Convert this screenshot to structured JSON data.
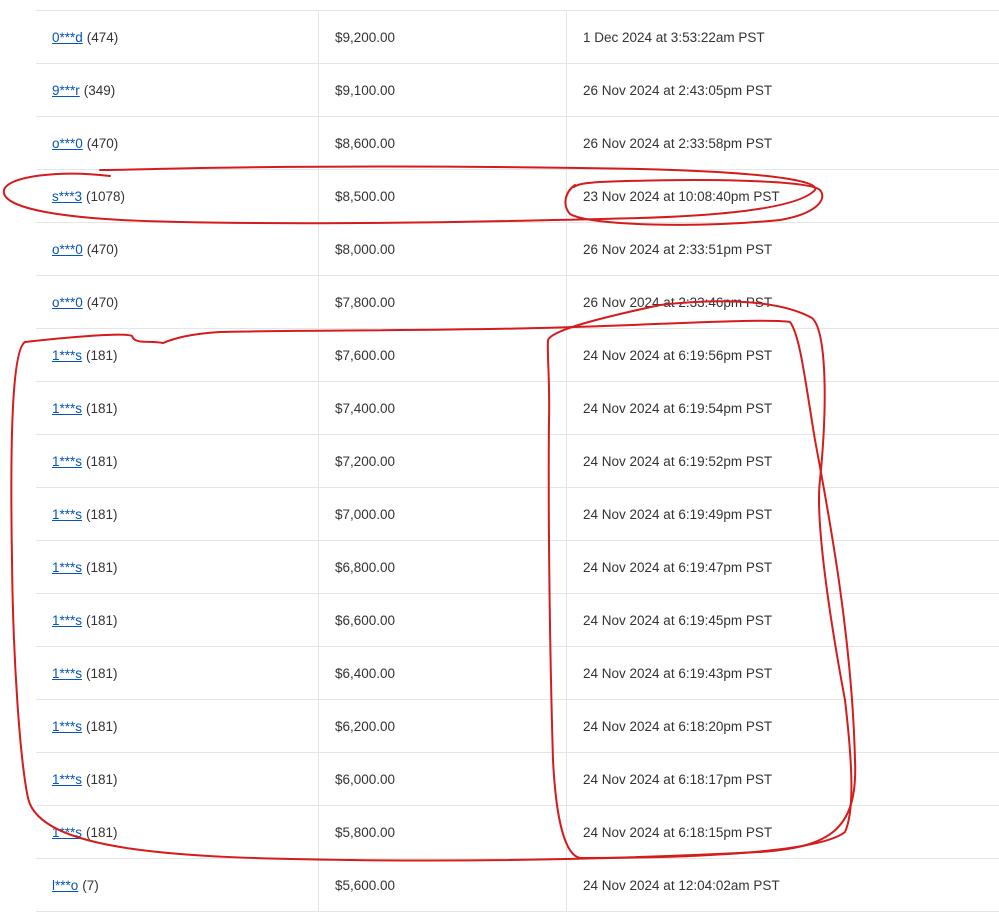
{
  "bids": [
    {
      "bidder": "0***d",
      "feedback": "(474)",
      "amount": "$9,200.00",
      "time": "1 Dec 2024 at 3:53:22am PST"
    },
    {
      "bidder": "9***r",
      "feedback": "(349)",
      "amount": "$9,100.00",
      "time": "26 Nov 2024 at 2:43:05pm PST"
    },
    {
      "bidder": "o***0",
      "feedback": "(470)",
      "amount": "$8,600.00",
      "time": "26 Nov 2024 at 2:33:58pm PST"
    },
    {
      "bidder": "s***3",
      "feedback": "(1078)",
      "amount": "$8,500.00",
      "time": "23 Nov 2024 at 10:08:40pm PST"
    },
    {
      "bidder": "o***0",
      "feedback": "(470)",
      "amount": "$8,000.00",
      "time": "26 Nov 2024 at 2:33:51pm PST"
    },
    {
      "bidder": "o***0",
      "feedback": "(470)",
      "amount": "$7,800.00",
      "time": "26 Nov 2024 at 2:33:46pm PST"
    },
    {
      "bidder": "1***s",
      "feedback": "(181)",
      "amount": "$7,600.00",
      "time": "24 Nov 2024 at 6:19:56pm PST"
    },
    {
      "bidder": "1***s",
      "feedback": "(181)",
      "amount": "$7,400.00",
      "time": "24 Nov 2024 at 6:19:54pm PST"
    },
    {
      "bidder": "1***s",
      "feedback": "(181)",
      "amount": "$7,200.00",
      "time": "24 Nov 2024 at 6:19:52pm PST"
    },
    {
      "bidder": "1***s",
      "feedback": "(181)",
      "amount": "$7,000.00",
      "time": "24 Nov 2024 at 6:19:49pm PST"
    },
    {
      "bidder": "1***s",
      "feedback": "(181)",
      "amount": "$6,800.00",
      "time": "24 Nov 2024 at 6:19:47pm PST"
    },
    {
      "bidder": "1***s",
      "feedback": "(181)",
      "amount": "$6,600.00",
      "time": "24 Nov 2024 at 6:19:45pm PST"
    },
    {
      "bidder": "1***s",
      "feedback": "(181)",
      "amount": "$6,400.00",
      "time": "24 Nov 2024 at 6:19:43pm PST"
    },
    {
      "bidder": "1***s",
      "feedback": "(181)",
      "amount": "$6,200.00",
      "time": "24 Nov 2024 at 6:18:20pm PST"
    },
    {
      "bidder": "1***s",
      "feedback": "(181)",
      "amount": "$6,000.00",
      "time": "24 Nov 2024 at 6:18:17pm PST"
    },
    {
      "bidder": "1***s",
      "feedback": "(181)",
      "amount": "$5,800.00",
      "time": "24 Nov 2024 at 6:18:15pm PST"
    },
    {
      "bidder": "l***o",
      "feedback": "(7)",
      "amount": "$5,600.00",
      "time": "24 Nov 2024 at 12:04:02am PST"
    }
  ],
  "colors": {
    "link": "#0654ba",
    "annotation": "#d41c1c",
    "border": "#e5e5e5"
  }
}
